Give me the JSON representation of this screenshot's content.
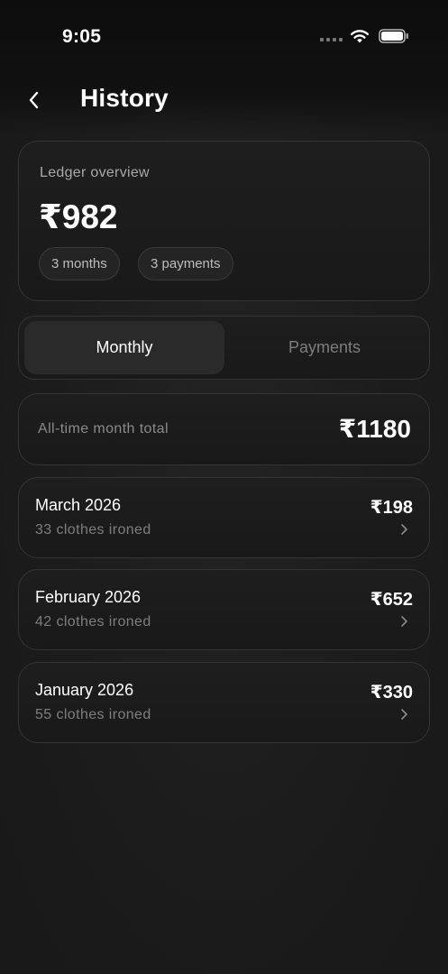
{
  "status_bar": {
    "time": "9:05"
  },
  "header": {
    "title": "History"
  },
  "overview": {
    "label": "Ledger overview",
    "amount": "₹982",
    "chips": [
      "3 months",
      "3 payments"
    ]
  },
  "tabs": [
    {
      "label": "Monthly",
      "selected": true
    },
    {
      "label": "Payments",
      "selected": false
    }
  ],
  "total": {
    "label": "All-time month total",
    "amount": "₹1180"
  },
  "months": [
    {
      "name": "March 2026",
      "subtitle": "33 clothes ironed",
      "amount": "₹198"
    },
    {
      "name": "February 2026",
      "subtitle": "42 clothes ironed",
      "amount": "₹652"
    },
    {
      "name": "January 2026",
      "subtitle": "55 clothes ironed",
      "amount": "₹330"
    }
  ],
  "colors": {
    "background": "#1b1b1b",
    "card": "#1e1e1e",
    "border": "#343434",
    "text": "#ffffff",
    "muted": "#7e7e7e"
  },
  "icons": [
    "back-icon",
    "signal-icon",
    "wifi-icon",
    "battery-icon",
    "chevron-right-icon"
  ]
}
